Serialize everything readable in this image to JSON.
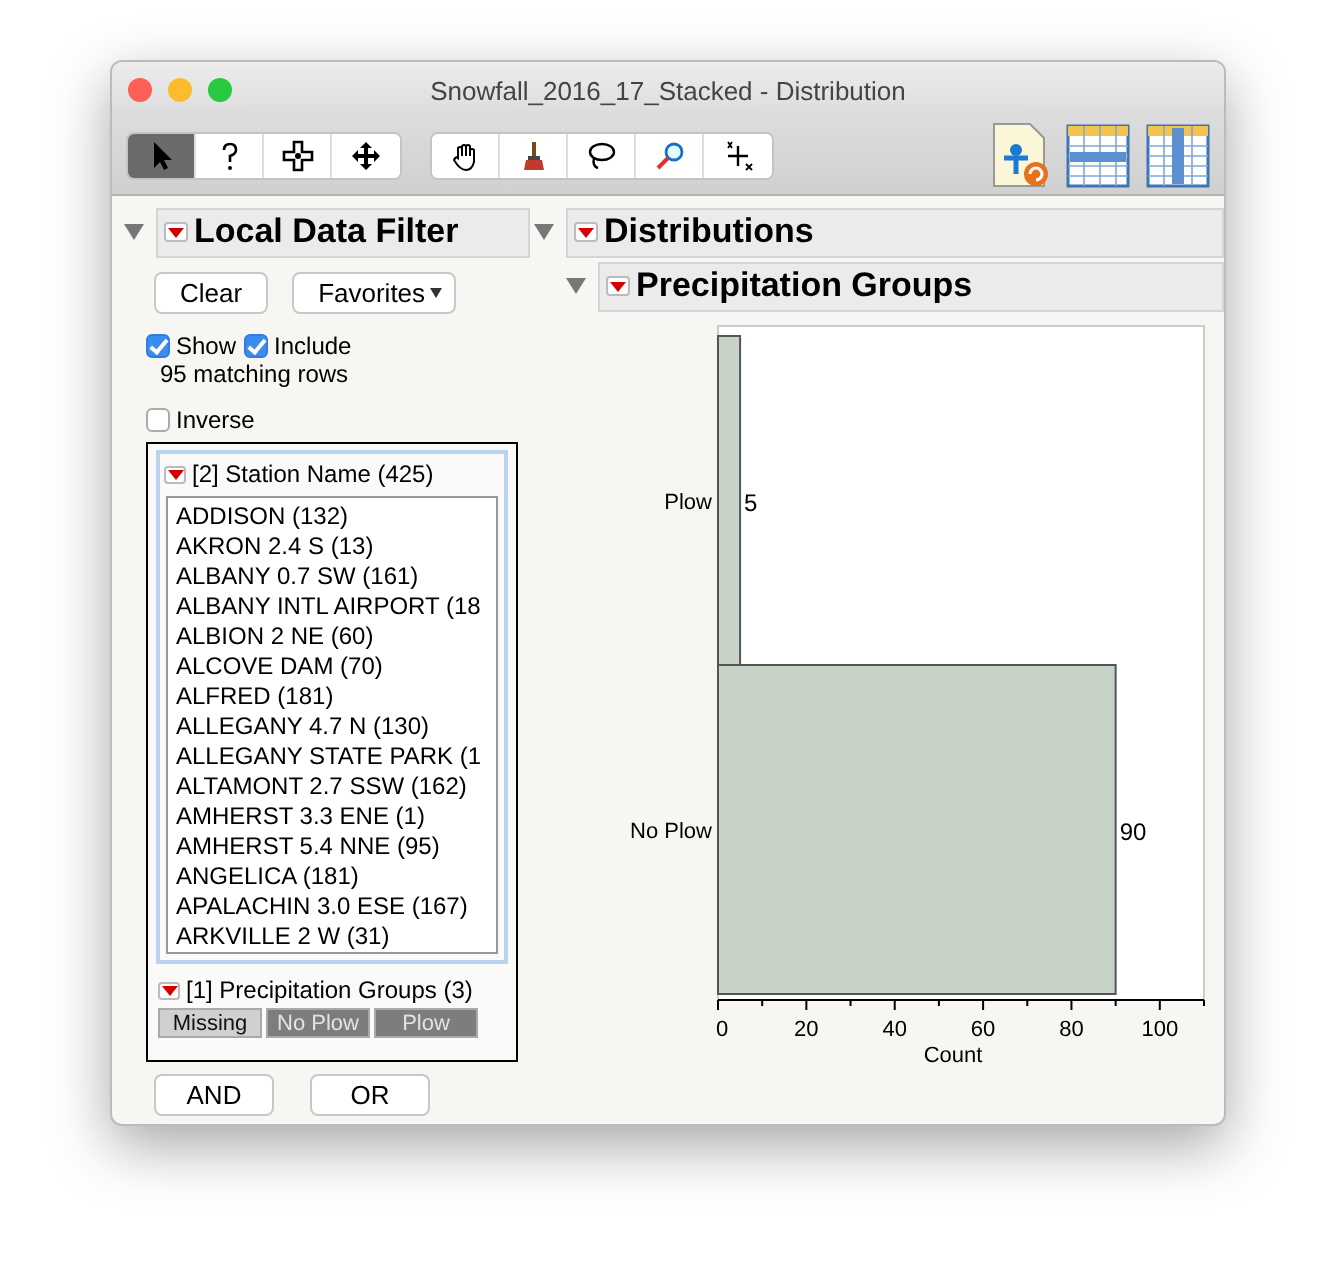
{
  "window": {
    "title": "Snowfall_2016_17_Stacked - Distribution"
  },
  "toolbar": {
    "tools": [
      {
        "kind": "arrow",
        "selected": true
      },
      {
        "kind": "help",
        "selected": false
      },
      {
        "kind": "crosshair",
        "selected": false
      },
      {
        "kind": "move",
        "selected": false
      },
      {
        "kind": "hand",
        "selected": false
      },
      {
        "kind": "brush",
        "selected": false
      },
      {
        "kind": "lasso",
        "selected": false
      },
      {
        "kind": "magnifier",
        "selected": false
      },
      {
        "kind": "scaler",
        "selected": false
      }
    ]
  },
  "filter": {
    "title": "Local Data Filter",
    "clear_button": "Clear",
    "favorites_button": "Favorites",
    "show": {
      "label": "Show",
      "checked": true
    },
    "include": {
      "label": "Include",
      "checked": true
    },
    "matching": "95 matching rows",
    "inverse": {
      "label": "Inverse",
      "checked": false
    },
    "station_filter": {
      "title": "[2] Station Name (425)",
      "items": [
        "ADDISON (132)",
        "AKRON 2.4 S (13)",
        "ALBANY 0.7 SW (161)",
        "ALBANY INTL AIRPORT (18",
        "ALBION 2 NE (60)",
        "ALCOVE DAM (70)",
        "ALFRED (181)",
        "ALLEGANY 4.7 N (130)",
        "ALLEGANY STATE PARK (1",
        "ALTAMONT 2.7 SSW (162)",
        "AMHERST 3.3 ENE (1)",
        "AMHERST 5.4 NNE (95)",
        "ANGELICA (181)",
        "APALACHIN 3.0 ESE (167)",
        "ARKVILLE 2 W (31)"
      ]
    },
    "group_filter": {
      "title": "[1] Precipitation Groups (3)",
      "levels": [
        {
          "label": "Missing",
          "selected": false
        },
        {
          "label": "No Plow",
          "selected": true
        },
        {
          "label": "Plow",
          "selected": true
        }
      ]
    },
    "logic_buttons": [
      "AND",
      "OR"
    ]
  },
  "report": {
    "title": "Distributions",
    "section": {
      "title": "Precipitation Groups",
      "chart_data": {
        "type": "bar",
        "orientation": "horizontal",
        "categories": [
          "Plow",
          "No Plow"
        ],
        "values": [
          5,
          90
        ],
        "xlabel": "Count",
        "xlim": [
          0,
          110
        ],
        "xticks": [
          0,
          20,
          40,
          60,
          80,
          100
        ],
        "data_labels": true
      }
    }
  }
}
